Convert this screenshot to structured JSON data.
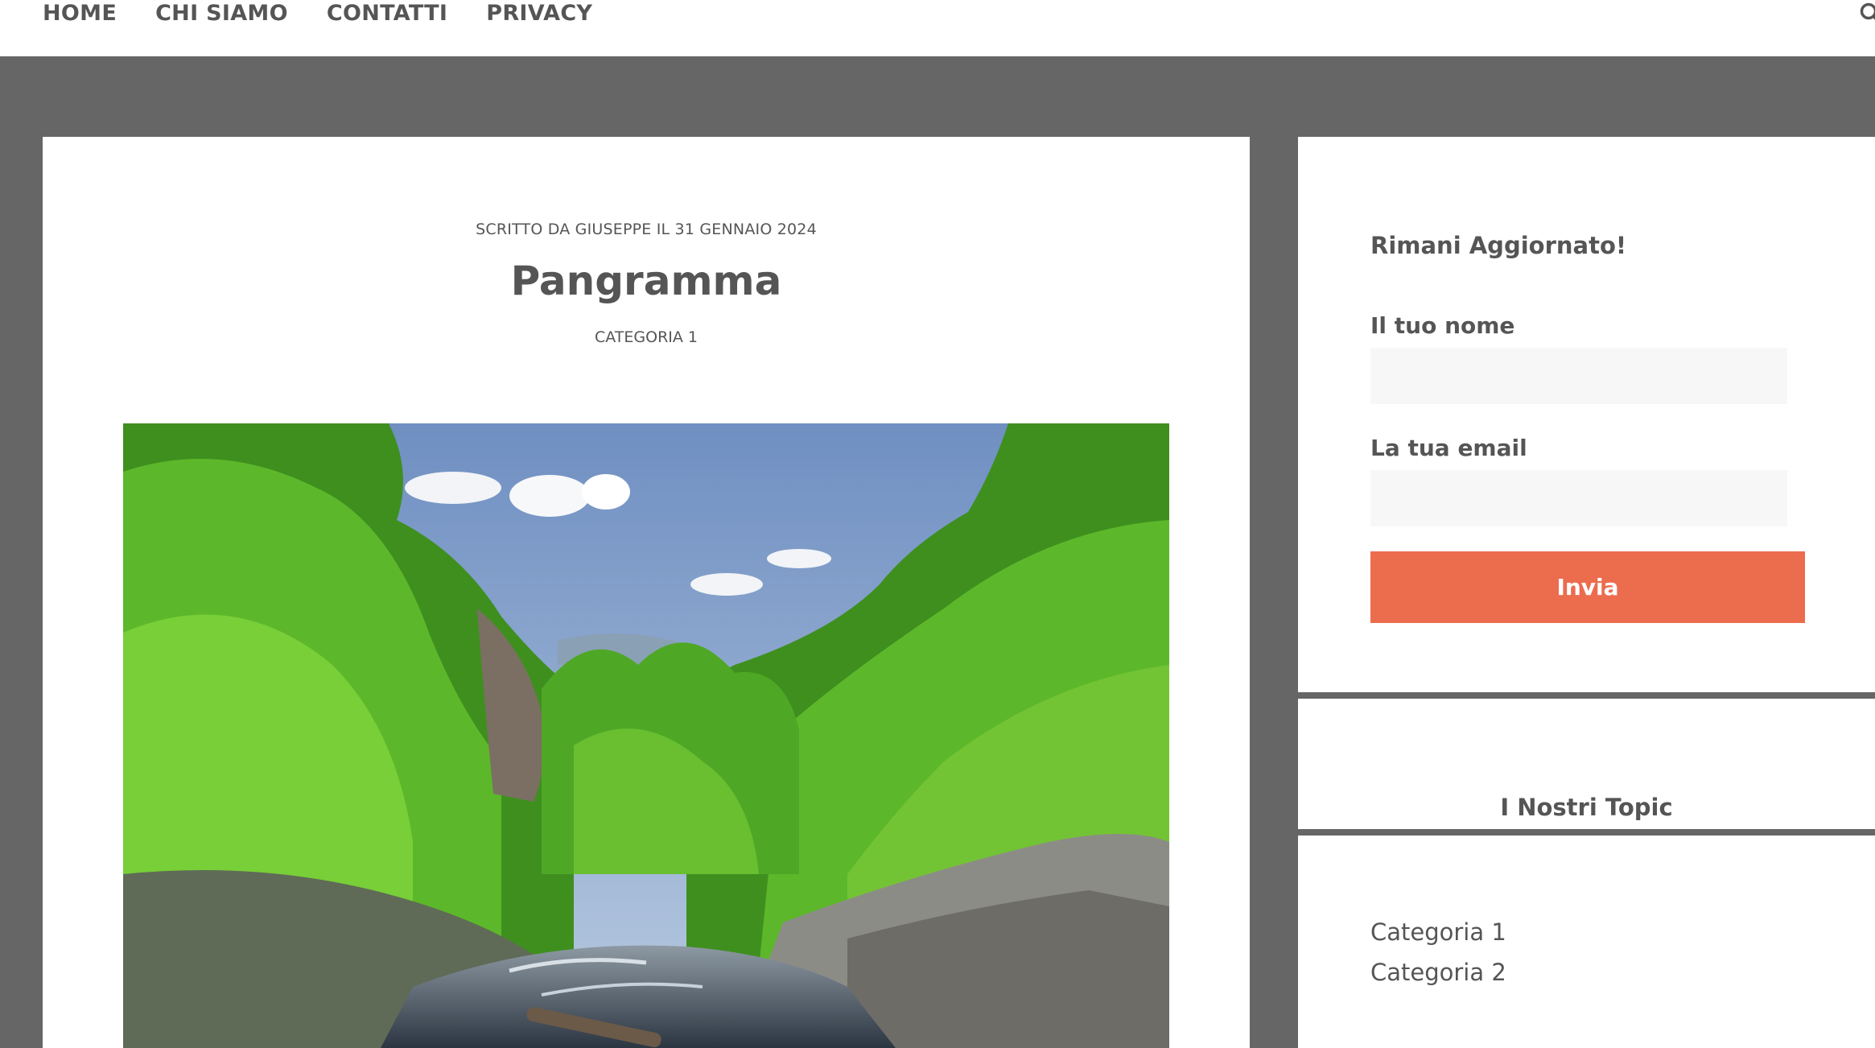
{
  "nav": {
    "items": [
      {
        "label": "HOME"
      },
      {
        "label": "CHI SIAMO"
      },
      {
        "label": "CONTATTI"
      },
      {
        "label": "PRIVACY"
      }
    ]
  },
  "article": {
    "meta": "SCRITTO DA GIUSEPPE IL 31 GENNAIO 2024",
    "title": "Pangramma",
    "category": "CATEGORIA 1"
  },
  "subscribe": {
    "title": "Rimani Aggiornato!",
    "name_label": "Il tuo nome",
    "name_value": "",
    "email_label": "La tua email",
    "email_value": "",
    "submit_label": "Invia"
  },
  "topics": {
    "title": "I Nostri Topic",
    "items": [
      {
        "label": "Categoria 1"
      },
      {
        "label": "Categoria 2"
      }
    ]
  },
  "colors": {
    "background": "#666666",
    "accent": "#ec6c4e",
    "text": "#555555"
  },
  "icons": {
    "search": "search-icon"
  }
}
